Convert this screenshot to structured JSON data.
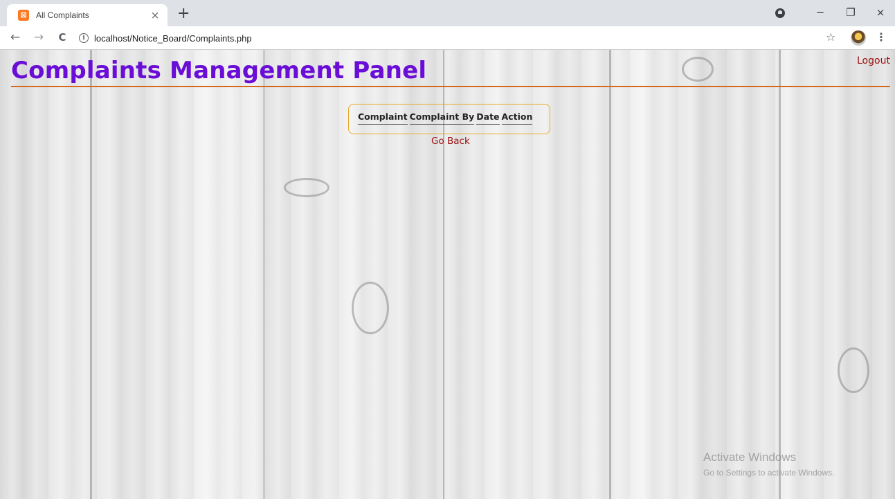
{
  "browser": {
    "tab_title": "All Complaints",
    "tab_close": "×",
    "new_tab": "+",
    "favicon": "⊠",
    "url": "localhost/Notice_Board/Complaints.php",
    "icons": [
      "back-arrow-icon",
      "forward-arrow-icon",
      "reload-icon",
      "info-icon",
      "star-icon",
      "profile-avatar-icon",
      "menu-dots-icon"
    ],
    "nav": {
      "back": "←",
      "forward": "→",
      "reload": "C"
    },
    "window_controls": {
      "minimize": "−",
      "restore": "❐",
      "close": "×"
    }
  },
  "page": {
    "title": "Complaints Management Panel",
    "logout_label": "Logout",
    "table": {
      "headers": [
        "Complaint",
        "Complaint By",
        "Date",
        "Action"
      ]
    },
    "go_back_label": "Go Back",
    "colors": {
      "title": "#6a0dd6",
      "rule": "#d2691e",
      "link": "#a01010",
      "table_border": "#e8a92a"
    }
  },
  "watermark": {
    "line1": "Activate Windows",
    "line2": "Go to Settings to activate Windows."
  }
}
